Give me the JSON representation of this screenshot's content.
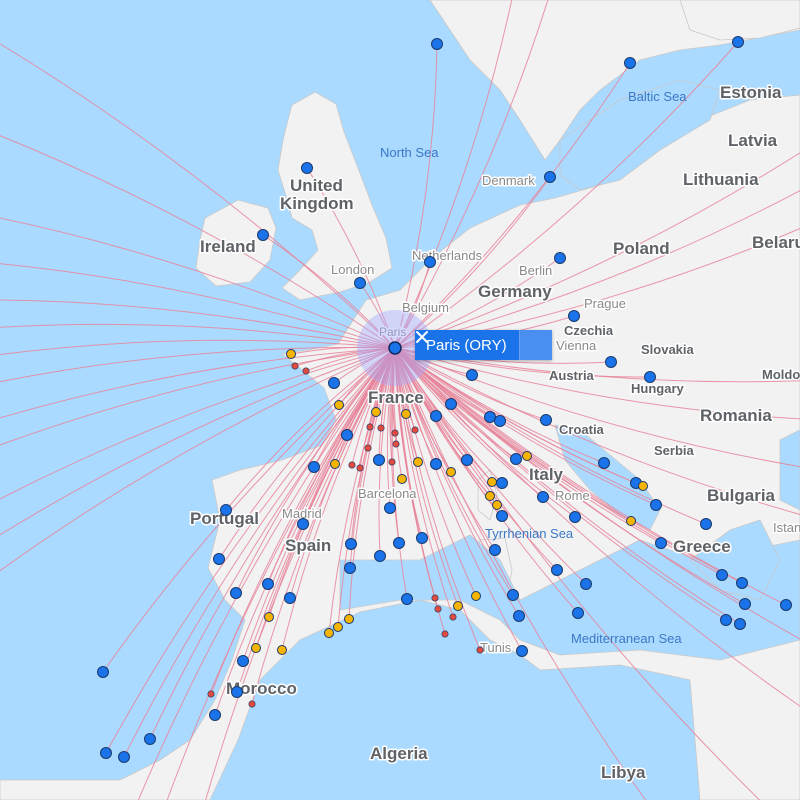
{
  "map": {
    "popup": {
      "label": "Paris (ORY)",
      "close_icon": "close-icon"
    },
    "countries": [
      {
        "id": "estonia",
        "name": "Estonia"
      },
      {
        "id": "latvia",
        "name": "Latvia"
      },
      {
        "id": "lithuania",
        "name": "Lithuania"
      },
      {
        "id": "belarus",
        "name": "Belaru"
      },
      {
        "id": "united-kingdom-1",
        "name": "United"
      },
      {
        "id": "united-kingdom-2",
        "name": "Kingdom"
      },
      {
        "id": "ireland",
        "name": "Ireland"
      },
      {
        "id": "poland",
        "name": "Poland"
      },
      {
        "id": "germany",
        "name": "Germany"
      },
      {
        "id": "czechia",
        "name": "Czechia"
      },
      {
        "id": "slovakia",
        "name": "Slovakia"
      },
      {
        "id": "austria",
        "name": "Austria"
      },
      {
        "id": "hungary",
        "name": "Hungary"
      },
      {
        "id": "moldova",
        "name": "Moldo"
      },
      {
        "id": "romania",
        "name": "Romania"
      },
      {
        "id": "croatia",
        "name": "Croatia"
      },
      {
        "id": "serbia",
        "name": "Serbia"
      },
      {
        "id": "france",
        "name": "France"
      },
      {
        "id": "italy",
        "name": "Italy"
      },
      {
        "id": "bulgaria",
        "name": "Bulgaria"
      },
      {
        "id": "portugal",
        "name": "Portugal"
      },
      {
        "id": "spain",
        "name": "Spain"
      },
      {
        "id": "greece",
        "name": "Greece"
      },
      {
        "id": "morocco",
        "name": "Morocco"
      },
      {
        "id": "algeria",
        "name": "Algeria"
      },
      {
        "id": "libya",
        "name": "Libya"
      },
      {
        "id": "tunisia",
        "name": "Tunis"
      },
      {
        "id": "istanbul",
        "name": "Istan"
      }
    ],
    "cities": [
      {
        "id": "london",
        "name": "London"
      },
      {
        "id": "denmark",
        "name": "Denmark"
      },
      {
        "id": "netherlands",
        "name": "Netherlands"
      },
      {
        "id": "berlin",
        "name": "Berlin"
      },
      {
        "id": "belgium",
        "name": "Belgium"
      },
      {
        "id": "prague",
        "name": "Prague"
      },
      {
        "id": "paris",
        "name": "Paris"
      },
      {
        "id": "vienna",
        "name": "Vienna"
      },
      {
        "id": "madrid",
        "name": "Madrid"
      },
      {
        "id": "barcelona",
        "name": "Barcelona"
      },
      {
        "id": "rome",
        "name": "Rome"
      }
    ],
    "seas": [
      {
        "id": "baltic-sea",
        "name": "Baltic Sea"
      },
      {
        "id": "north-sea",
        "name": "North Sea"
      },
      {
        "id": "tyrrhenian-sea",
        "name": "Tyrrhenian Sea"
      },
      {
        "id": "mediterranean-sea",
        "name": "Mediterranean Sea"
      }
    ],
    "colors": {
      "water": "#aadaff",
      "land": "#f2f2f2",
      "route": "#e8849a",
      "hub": "#1a73e8",
      "dest_blue": "#1a73e8",
      "dest_yellow": "#f5b400",
      "dest_red": "#e04a3f"
    },
    "destinations": {
      "blue_count": 62,
      "yellow_count": 22,
      "red_count": 23
    }
  }
}
